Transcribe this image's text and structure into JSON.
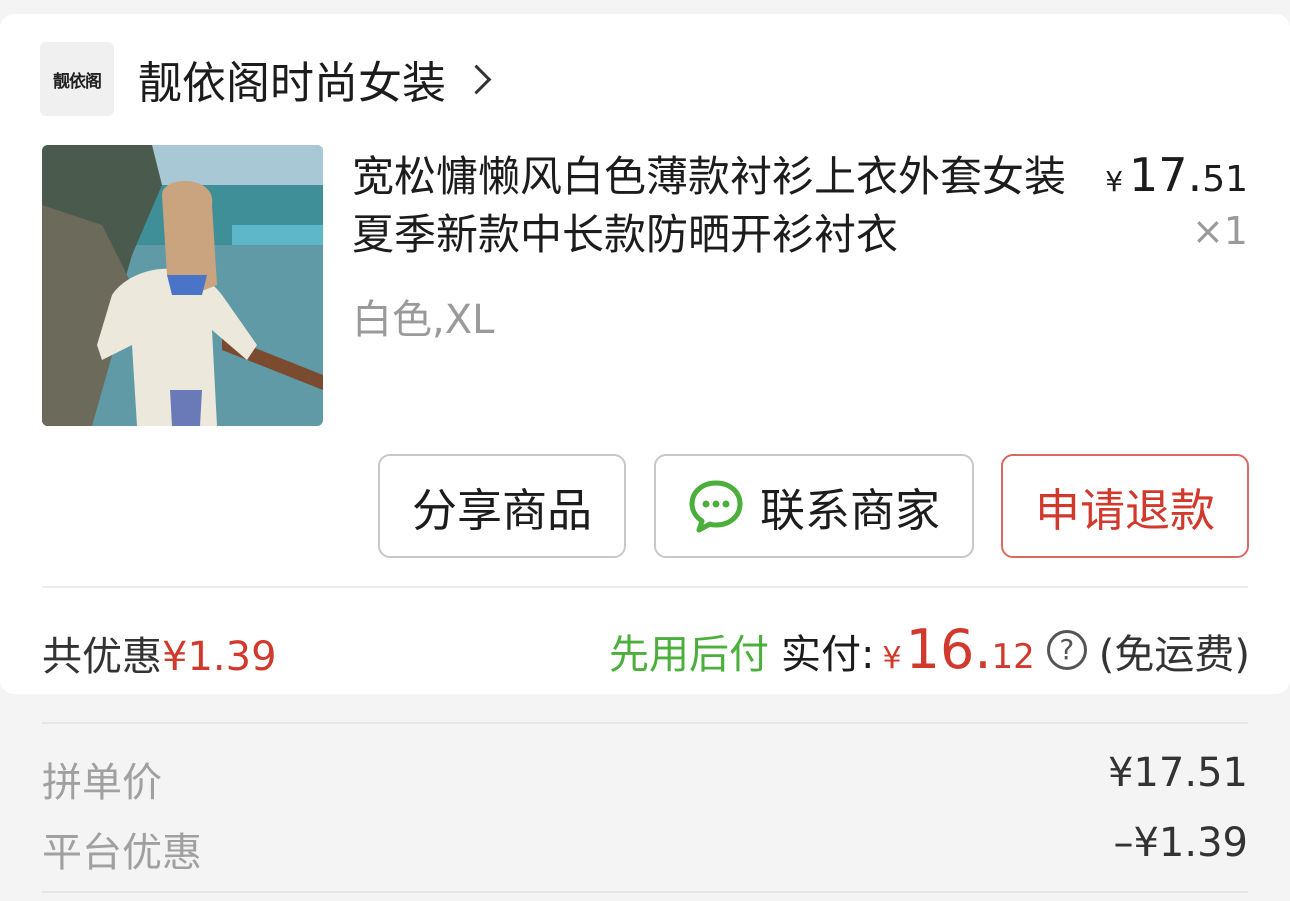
{
  "store": {
    "logo_text": "靓依阁",
    "name": "靓依阁时尚女装"
  },
  "product": {
    "title": "宽松慵懒风白色薄款衬衫上衣外套女装夏季新款中长款防晒开衫衬衣",
    "sku": "白色,XL",
    "price_currency": "¥",
    "price_int": "17.",
    "price_dec": "51",
    "quantity": "×1"
  },
  "buttons": {
    "share": "分享商品",
    "contact": "联系商家",
    "refund": "申请退款"
  },
  "summary": {
    "discount_label": "共优惠",
    "discount_amount": "¥1.39",
    "bnpl_label": "先用后付",
    "paid_label": "实付:",
    "paid_currency": "¥",
    "paid_int": "16.",
    "paid_dec": "12",
    "help_symbol": "?",
    "shipping_note": "(免运费)"
  },
  "details": [
    {
      "label": "拼单价",
      "value": "¥17.51"
    },
    {
      "label": "平台优惠",
      "value": "–¥1.39"
    }
  ],
  "colors": {
    "accent_red": "#d0392b",
    "bnpl_green": "#4caf3b",
    "wechat_green": "#4caf3b"
  }
}
